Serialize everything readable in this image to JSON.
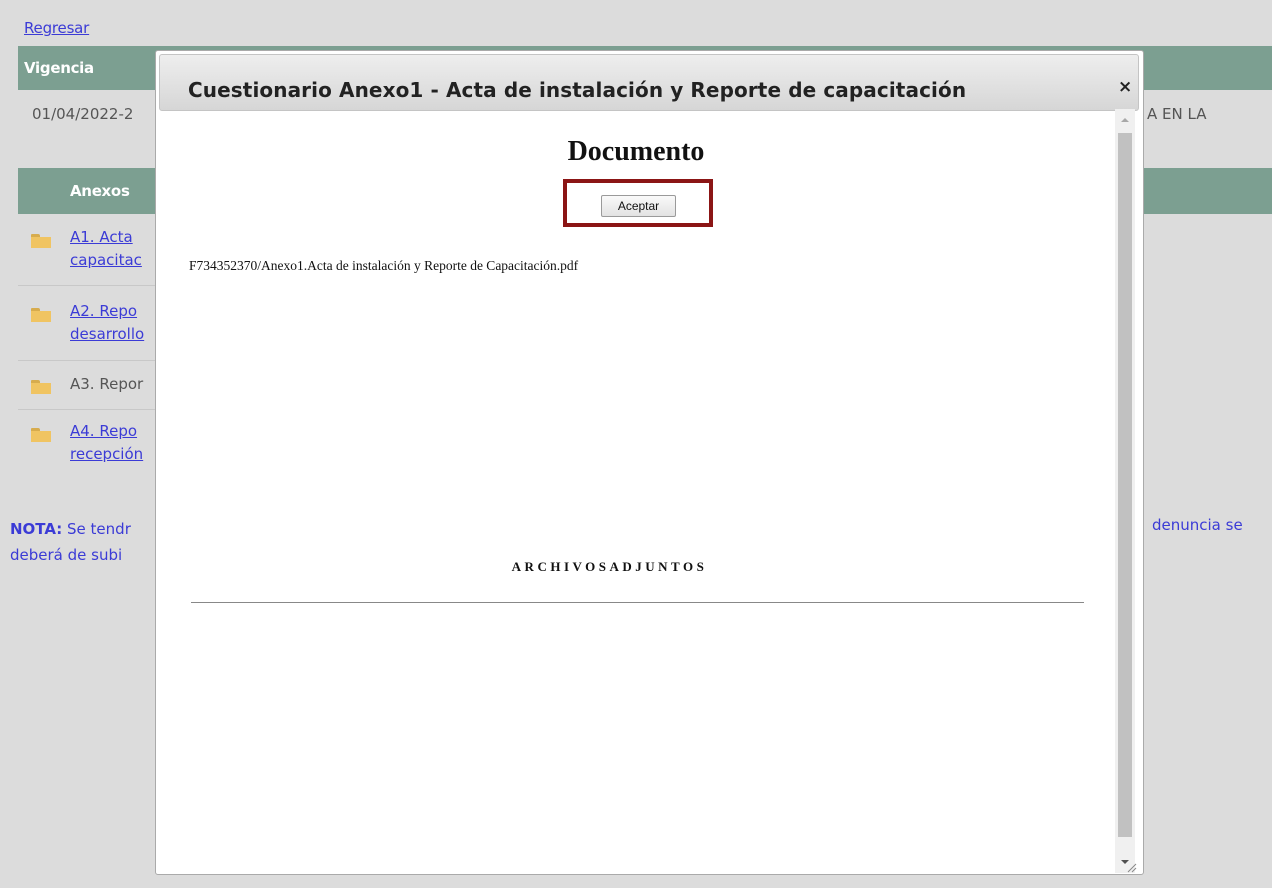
{
  "page": {
    "back_link": "Regresar",
    "vigencia_label": "Vigencia",
    "vigencia_value": "01/04/2022-2",
    "right_text_1": "A EN LA",
    "anexos_label": "Anexos",
    "annexes": [
      {
        "line1": " A1. Acta ",
        "line2": "capacitac",
        "link": true
      },
      {
        "line1": " A2. Repo",
        "line2": "desarrollo",
        "link": true
      },
      {
        "line1": "A3. Repor",
        "line2": "",
        "link": false
      },
      {
        "line1": " A4. Repo",
        "line2": "recepción",
        "link": true
      }
    ],
    "note_label": "NOTA:",
    "note_text": " Se tendr",
    "note_line2": "deberá de subi",
    "note_right": "denuncia se"
  },
  "modal": {
    "title": "Cuestionario Anexo1 - Acta de instalación y Reporte de capacitación",
    "close_symbol": "×",
    "doc_title": "Documento",
    "accept_label": "Aceptar",
    "file_path": "F734352370/Anexo1.Acta de instalación y Reporte de Capacitación.pdf",
    "attachments_title": "ARCHIVOSADJUNTOS"
  },
  "colors": {
    "header_bar": "#7c9f91",
    "link": "#3b3bd6",
    "highlight": "#8b1515",
    "folder": "#f0c462"
  },
  "icons": [
    "folder-icon",
    "close-icon",
    "scroll-up-icon",
    "scroll-down-icon",
    "resize-grip-icon"
  ]
}
